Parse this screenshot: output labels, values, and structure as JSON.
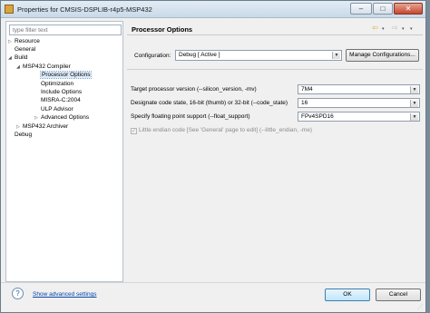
{
  "window": {
    "title": "Properties for CMSIS-DSPLIB-r4p5-MSP432"
  },
  "titlebar": {
    "minimize_glyph": "–",
    "maximize_glyph": "□",
    "close_glyph": "✕"
  },
  "sidebar": {
    "filter_placeholder": "type filter text",
    "items": [
      {
        "label": "Resource",
        "arrow": "▷"
      },
      {
        "label": "General",
        "arrow": ""
      },
      {
        "label": "Build",
        "arrow": "◢"
      },
      {
        "label": "MSP432 Compiler",
        "arrow": "◢"
      },
      {
        "label": "Processor Options",
        "arrow": ""
      },
      {
        "label": "Optimization",
        "arrow": ""
      },
      {
        "label": "Include Options",
        "arrow": ""
      },
      {
        "label": "MISRA-C:2004",
        "arrow": ""
      },
      {
        "label": "ULP Advisor",
        "arrow": ""
      },
      {
        "label": "Advanced Options",
        "arrow": "▷"
      },
      {
        "label": "MSP432 Archiver",
        "arrow": "▷"
      },
      {
        "label": "Debug",
        "arrow": ""
      }
    ]
  },
  "content": {
    "page_title": "Processor Options",
    "nav": {
      "back": "⇦",
      "forward": "⇨",
      "dropdown": "▾"
    },
    "configuration_label": "Configuration:",
    "configuration_value": "Debug  [ Active ]",
    "manage_button": "Manage Configurations...",
    "options": [
      {
        "label": "Target processor version (--silicon_version, -mv)",
        "value": "7M4"
      },
      {
        "label": "Designate code state, 16-bit (thumb) or 32-bit (--code_state)",
        "value": "16"
      },
      {
        "label": "Specify floating point support (--float_support)",
        "value": "FPv4SPD16"
      }
    ],
    "checkbox_label": "Little endian code [See 'General' page to edit] (--little_endian, -me)",
    "checkbox_mark": "✓"
  },
  "footer": {
    "help_glyph": "?",
    "advanced_link": "Show advanced settings",
    "ok": "OK",
    "cancel": "Cancel"
  }
}
